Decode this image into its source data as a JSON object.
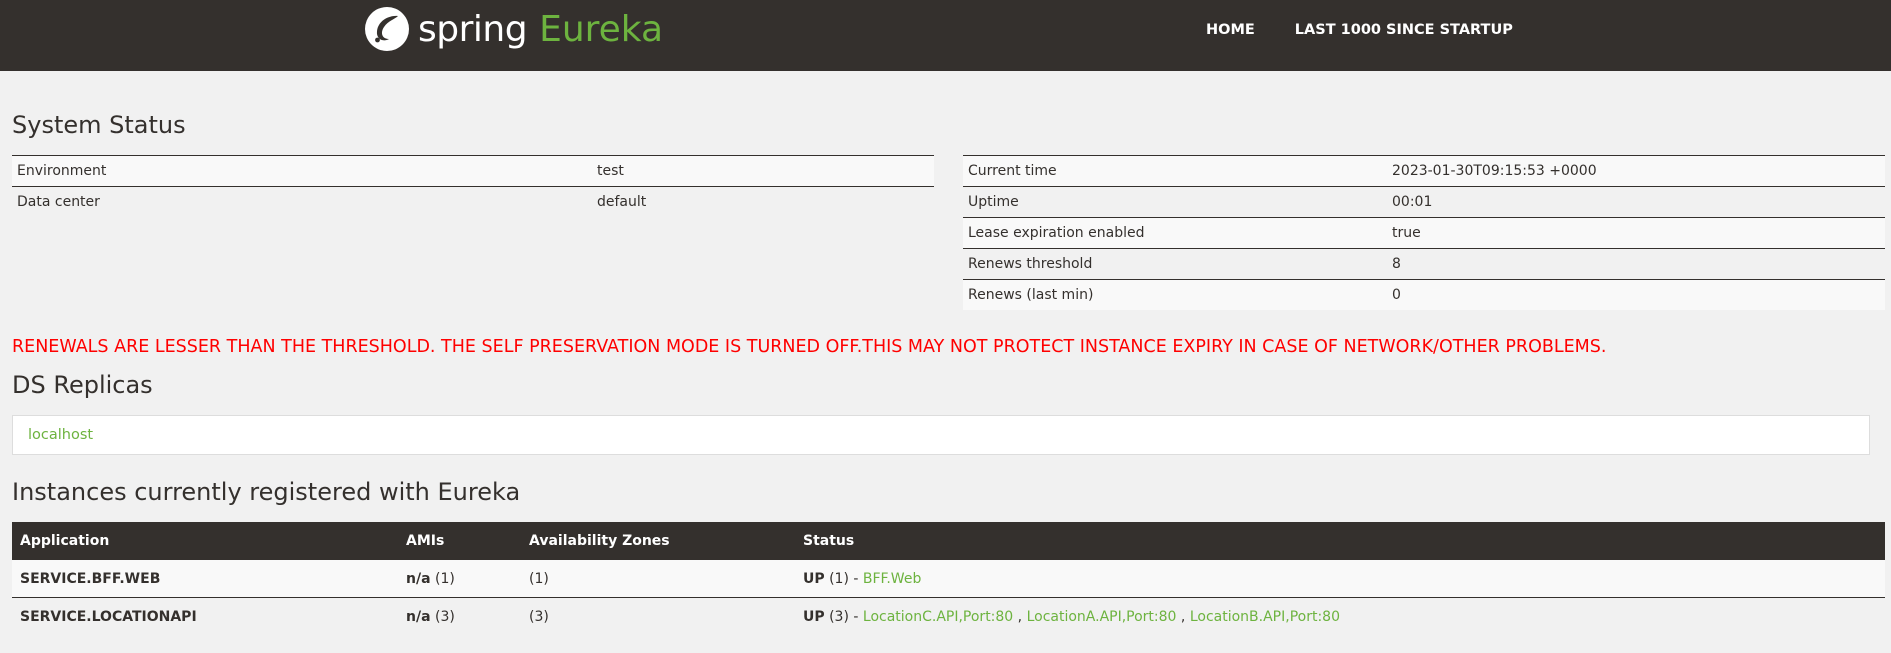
{
  "brand": {
    "name_spring": "spring",
    "name_eureka": "Eureka"
  },
  "nav": {
    "items": [
      {
        "label": "HOME"
      },
      {
        "label": "LAST 1000 SINCE STARTUP"
      }
    ]
  },
  "system_status": {
    "title": "System Status",
    "left": [
      {
        "label": "Environment",
        "value": "test"
      },
      {
        "label": "Data center",
        "value": "default"
      }
    ],
    "right": [
      {
        "label": "Current time",
        "value": "2023-01-30T09:15:53 +0000"
      },
      {
        "label": "Uptime",
        "value": "00:01"
      },
      {
        "label": "Lease expiration enabled",
        "value": "true"
      },
      {
        "label": "Renews threshold",
        "value": "8"
      },
      {
        "label": "Renews (last min)",
        "value": "0"
      }
    ]
  },
  "warning": "RENEWALS ARE LESSER THAN THE THRESHOLD. THE SELF PRESERVATION MODE IS TURNED OFF.THIS MAY NOT PROTECT INSTANCE EXPIRY IN CASE OF NETWORK/OTHER PROBLEMS.",
  "ds_replicas": {
    "title": "DS Replicas",
    "items": [
      "localhost"
    ]
  },
  "instances": {
    "title": "Instances currently registered with Eureka",
    "columns": [
      "Application",
      "AMIs",
      "Availability Zones",
      "Status"
    ],
    "rows": [
      {
        "application": "SERVICE.BFF.WEB",
        "amis_na": "n/a",
        "amis_count": "(1)",
        "zones": "(1)",
        "status_state": "UP",
        "status_count": "(1) - ",
        "links": [
          "BFF.Web"
        ]
      },
      {
        "application": "SERVICE.LOCATIONAPI",
        "amis_na": "n/a",
        "amis_count": "(3)",
        "zones": "(3)",
        "status_state": "UP",
        "status_count": "(3) - ",
        "links": [
          "LocationC.API,Port:80",
          "LocationA.API,Port:80",
          "LocationB.API,Port:80"
        ]
      }
    ]
  },
  "colors": {
    "navbar": "#34302d",
    "accent": "#6db33f",
    "warning": "#ff0000",
    "background": "#f1f1f1"
  }
}
